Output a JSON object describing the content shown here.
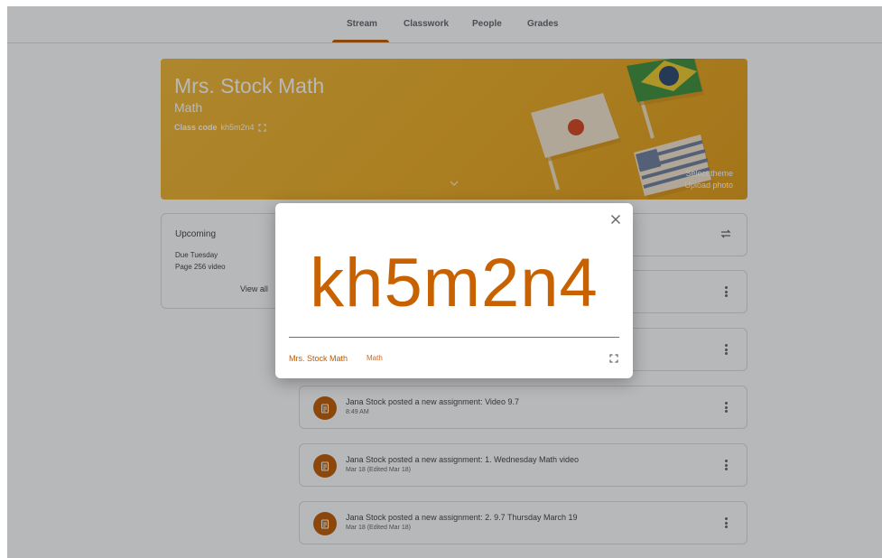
{
  "nav": {
    "tabs": [
      {
        "label": "Stream",
        "active": true
      },
      {
        "label": "Classwork"
      },
      {
        "label": "People"
      },
      {
        "label": "Grades"
      }
    ]
  },
  "banner": {
    "title": "Mrs. Stock Math",
    "subject": "Math",
    "code_label": "Class code",
    "code": "kh5m2n4",
    "select_theme": "Select theme",
    "upload_photo": "Upload photo"
  },
  "upcoming": {
    "title": "Upcoming",
    "due": "Due Tuesday",
    "item": "Page 256 video",
    "view_all": "View all"
  },
  "stream": {
    "posts": [
      {
        "title": "Jana Stock posted a new assignment: Video 9.7",
        "meta": "8:49 AM"
      },
      {
        "title": "Jana Stock posted a new assignment: 1. Wednesday Math video",
        "meta": "Mar 18 (Edited Mar 18)"
      },
      {
        "title": "Jana Stock posted a new assignment: 2. 9.7 Thursday March 19",
        "meta": "Mar 18 (Edited Mar 18)"
      }
    ]
  },
  "dialog": {
    "code": "kh5m2n4",
    "class_name": "Mrs. Stock Math",
    "subject": "Math"
  },
  "colors": {
    "accent": "#c05a00",
    "banner": "#ecab1f",
    "code_text": "#c86200"
  },
  "icons": [
    "close-icon",
    "fullscreen-icon",
    "repost-icon",
    "assignment-icon",
    "more-vert-icon",
    "chevron-down-icon"
  ]
}
